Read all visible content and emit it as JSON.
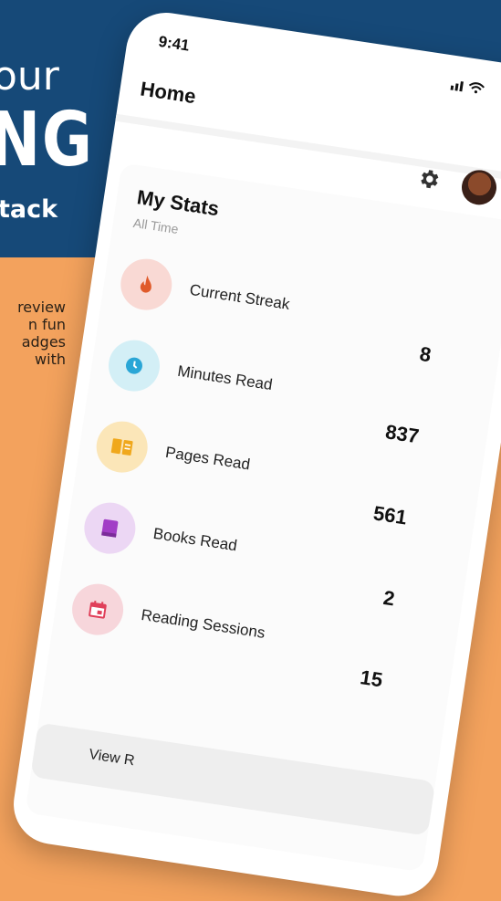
{
  "promo": {
    "line1": "our",
    "line2": "NG",
    "line3": "tack",
    "body": [
      "review",
      "n fun",
      "adges",
      "with"
    ]
  },
  "phone": {
    "status_time": "9:41",
    "status_icons": "signal wifi",
    "header_title": "Home",
    "icons": [
      "gear-icon",
      "avatar"
    ],
    "stats_title": "My Stats",
    "stats_subtitle": "All Time",
    "stats": [
      {
        "label": "Current Streak",
        "value": "8",
        "icon": "flame-icon",
        "bg": "#f9d9d4",
        "fg": "#e05a2a"
      },
      {
        "label": "Minutes Read",
        "value": "837",
        "icon": "clock-icon",
        "bg": "#d3eff6",
        "fg": "#2aa6d6"
      },
      {
        "label": "Pages Read",
        "value": "561",
        "icon": "book-open-icon",
        "bg": "#fbe6b8",
        "fg": "#f0a81c"
      },
      {
        "label": "Books Read",
        "value": "2",
        "icon": "book-icon",
        "bg": "#ecd7f4",
        "fg": "#a23ec6"
      },
      {
        "label": "Reading Sessions",
        "value": "15",
        "icon": "calendar-icon",
        "bg": "#f7d6db",
        "fg": "#e0405a"
      }
    ],
    "view_button": "View R"
  },
  "colors": {
    "band": "#164978",
    "orange": "#f3a25d"
  }
}
